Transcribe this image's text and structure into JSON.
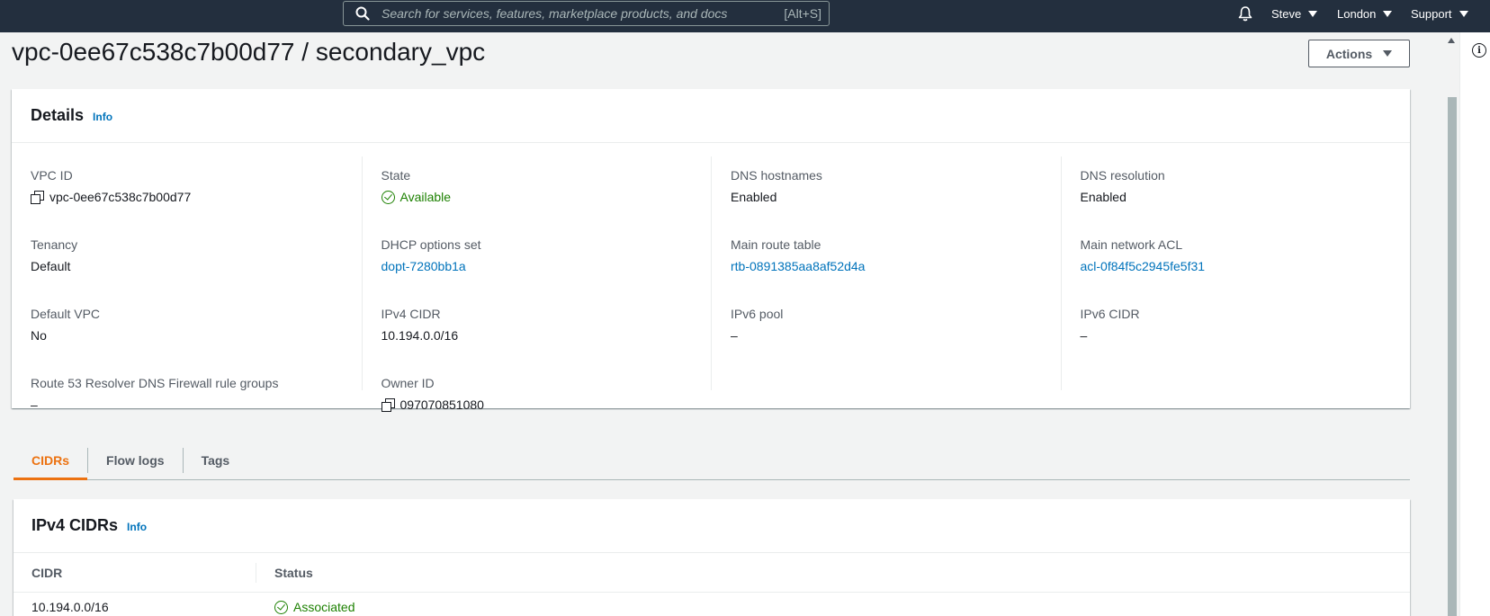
{
  "topnav": {
    "search_placeholder": "Search for services, features, marketplace products, and docs",
    "search_shortcut": "[Alt+S]",
    "user": "Steve",
    "region": "London",
    "support": "Support"
  },
  "page": {
    "title": "vpc-0ee67c538c7b00d77 / secondary_vpc",
    "actions_label": "Actions"
  },
  "details": {
    "heading": "Details",
    "info": "Info",
    "columns": [
      [
        {
          "label": "VPC ID",
          "value": "vpc-0ee67c538c7b00d77",
          "kind": "copy"
        },
        {
          "label": "Tenancy",
          "value": "Default",
          "kind": "text"
        },
        {
          "label": "Default VPC",
          "value": "No",
          "kind": "text"
        },
        {
          "label": "Route 53 Resolver DNS Firewall rule groups",
          "value": "–",
          "kind": "text"
        }
      ],
      [
        {
          "label": "State",
          "value": "Available",
          "kind": "status"
        },
        {
          "label": "DHCP options set",
          "value": "dopt-7280bb1a",
          "kind": "link"
        },
        {
          "label": "IPv4 CIDR",
          "value": "10.194.0.0/16",
          "kind": "text"
        },
        {
          "label": "Owner ID",
          "value": "097070851080",
          "kind": "copy"
        }
      ],
      [
        {
          "label": "DNS hostnames",
          "value": "Enabled",
          "kind": "text"
        },
        {
          "label": "Main route table",
          "value": "rtb-0891385aa8af52d4a",
          "kind": "link"
        },
        {
          "label": "IPv6 pool",
          "value": "–",
          "kind": "text"
        }
      ],
      [
        {
          "label": "DNS resolution",
          "value": "Enabled",
          "kind": "text"
        },
        {
          "label": "Main network ACL",
          "value": "acl-0f84f5c2945fe5f31",
          "kind": "link"
        },
        {
          "label": "IPv6 CIDR",
          "value": "–",
          "kind": "text"
        }
      ]
    ]
  },
  "tabs": [
    {
      "label": "CIDRs",
      "active": true
    },
    {
      "label": "Flow logs",
      "active": false
    },
    {
      "label": "Tags",
      "active": false
    }
  ],
  "ipv4_cidrs": {
    "heading": "IPv4 CIDRs",
    "info": "Info",
    "columns": [
      "CIDR",
      "Status"
    ],
    "rows": [
      {
        "cidr": "10.194.0.0/16",
        "status": "Associated"
      }
    ]
  },
  "colors": {
    "nav_bg": "#232f3e",
    "link": "#0073bb",
    "success": "#1d8102",
    "active_tab": "#ec7211"
  },
  "icons": [
    "search-icon",
    "bell-icon",
    "copy-icon",
    "check-circle-icon",
    "info-icon",
    "caret-down-icon"
  ]
}
